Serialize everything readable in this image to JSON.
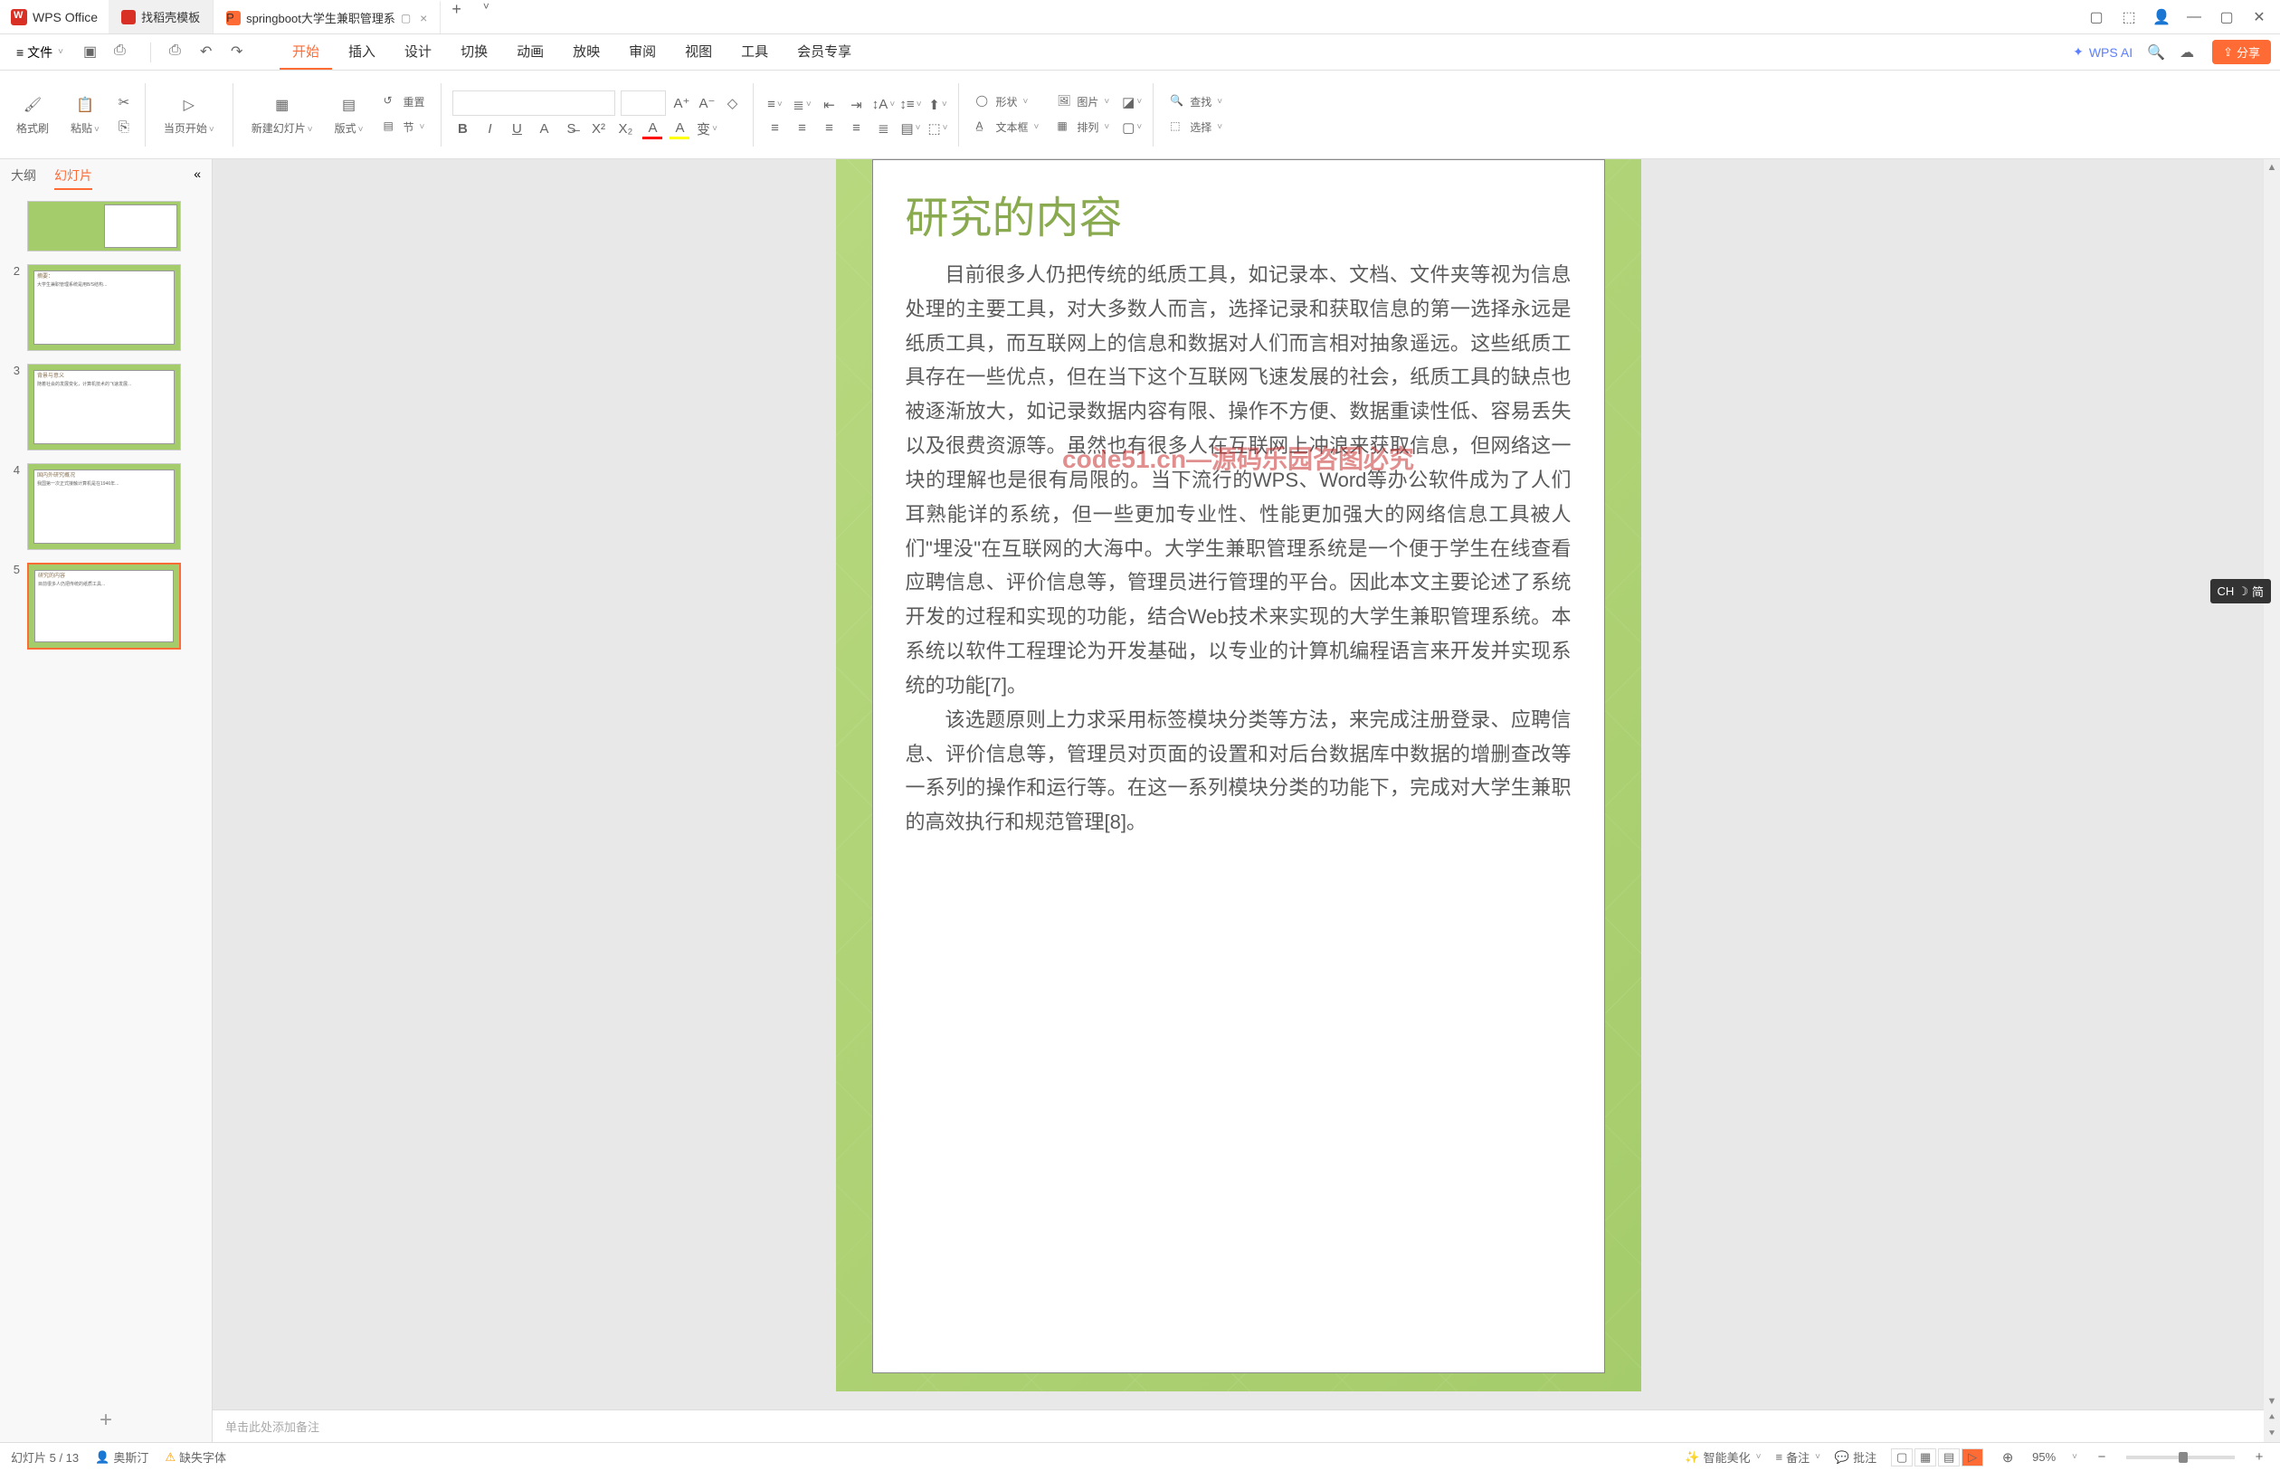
{
  "app": {
    "name": "WPS Office"
  },
  "tabs": [
    {
      "label": "找稻壳模板",
      "icon": "red"
    },
    {
      "label": "springboot大学生兼职管理系",
      "icon": "orange",
      "active": true
    }
  ],
  "menu": {
    "file": "文件",
    "items": [
      "开始",
      "插入",
      "设计",
      "切换",
      "动画",
      "放映",
      "审阅",
      "视图",
      "工具",
      "会员专享"
    ],
    "active": 0,
    "wps_ai": "WPS AI",
    "share": "分享"
  },
  "ribbon": {
    "format_brush": "格式刷",
    "paste": "粘贴",
    "from_current": "当页开始",
    "new_slide": "新建幻灯片",
    "layout": "版式",
    "reset": "重置",
    "section": "节",
    "shape": "形状",
    "textbox": "文本框",
    "picture": "图片",
    "arrange": "排列",
    "find": "查找",
    "select": "选择"
  },
  "side": {
    "outline": "大纲",
    "slides": "幻灯片",
    "thumbs": [
      {
        "title": "",
        "text": ""
      },
      {
        "title": "摘要：",
        "text": "大学生兼职管理系统是用B/S结构..."
      },
      {
        "title": "背景与意义",
        "text": "随着社会的发展变化，计算机技术的飞速发展..."
      },
      {
        "title": "国内外研究概况",
        "text": "我国第一次正式接触计算机是在1946年..."
      },
      {
        "title": "研究的内容",
        "text": "目前很多人仍把传统的纸质工具..."
      }
    ],
    "nums": [
      "",
      "2",
      "3",
      "4",
      "5"
    ]
  },
  "slide": {
    "title": "研究的内容",
    "para1": "目前很多人仍把传统的纸质工具，如记录本、文档、文件夹等视为信息处理的主要工具，对大多数人而言，选择记录和获取信息的第一选择永远是纸质工具，而互联网上的信息和数据对人们而言相对抽象遥远。这些纸质工具存在一些优点，但在当下这个互联网飞速发展的社会，纸质工具的缺点也被逐渐放大，如记录数据内容有限、操作不方便、数据重读性低、容易丢失以及很费资源等。虽然也有很多人在互联网上冲浪来获取信息，但网络这一块的理解也是很有局限的。当下流行的WPS、Word等办公软件成为了人们耳熟能详的系统，但一些更加专业性、性能更加强大的网络信息工具被人们\"埋没\"在互联网的大海中。大学生兼职管理系统是一个便于学生在线查看应聘信息、评价信息等，管理员进行管理的平台。因此本文主要论述了系统开发的过程和实现的功能，结合Web技术来实现的大学生兼职管理系统。本系统以软件工程理论为开发基础，以专业的计算机编程语言来开发并实现系统的功能[7]。",
    "para2": "该选题原则上力求采用标签模块分类等方法，来完成注册登录、应聘信息、评价信息等，管理员对页面的设置和对后台数据库中数据的增删查改等一系列的操作和运行等。在这一系列模块分类的功能下，完成对大学生兼职的高效执行和规范管理[8]。",
    "watermark": "code51.cn—源码乐园咨图必究"
  },
  "notes": {
    "placeholder": "单击此处添加备注"
  },
  "status": {
    "slide_pos": "幻灯片 5 / 13",
    "author": "奥斯汀",
    "missing_font": "缺失字体",
    "smart_beauty": "智能美化",
    "notes_btn": "备注",
    "review": "批注",
    "zoom": "95%"
  },
  "ime": {
    "lang": "CH",
    "mode": "简"
  }
}
